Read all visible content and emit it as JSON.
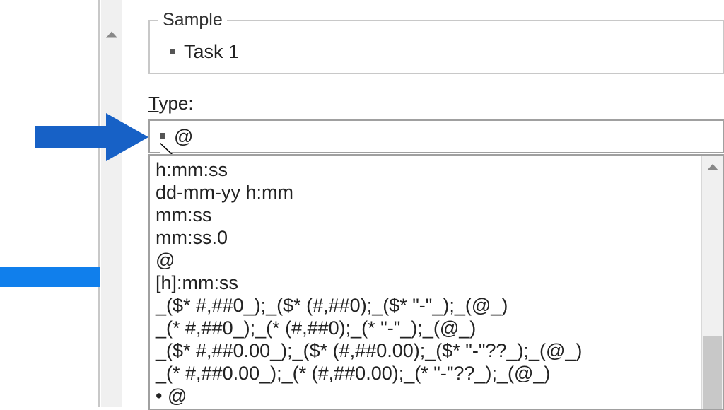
{
  "sample": {
    "legend": "Sample",
    "value": "Task 1"
  },
  "type": {
    "label_prefix": "T",
    "label_rest": "ype:",
    "input_value": "@"
  },
  "format_list": [
    "h:mm:ss",
    "dd-mm-yy h:mm",
    "mm:ss",
    "mm:ss.0",
    "@",
    "[h]:mm:ss",
    "_($* #,##0_);_($* (#,##0);_($* \"-\"_);_(@_)",
    "_(* #,##0_);_(* (#,##0);_(* \"-\"_);_(@_)",
    "_($* #,##0.00_);_($* (#,##0.00);_($* \"-\"??_);_(@_)",
    "_(* #,##0.00_);_(* (#,##0.00);_(* \"-\"??_);_(@_)",
    "• @"
  ],
  "colors": {
    "accent_blue": "#1761c6",
    "highlight_blue": "#107fec"
  }
}
